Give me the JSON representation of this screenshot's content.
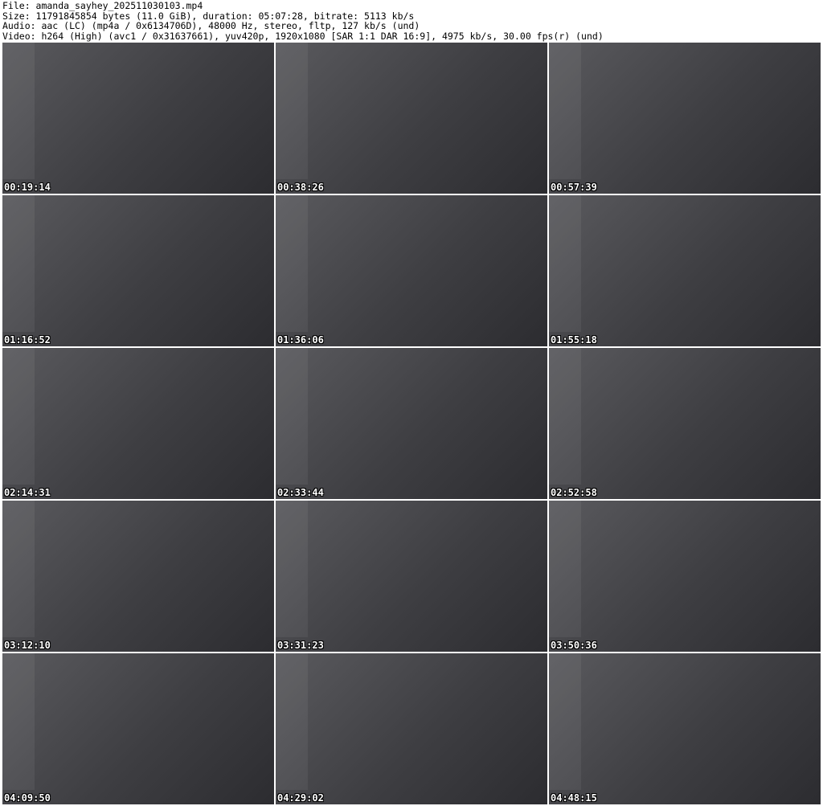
{
  "header": {
    "file": "File: amanda_sayhey_202511030103.mp4",
    "size": "Size: 11791845854 bytes (11.0 GiB), duration: 05:07:28, bitrate: 5113 kb/s",
    "audio": "Audio: aac (LC) (mp4a / 0x6134706D), 48000 Hz, stereo, fltp, 127 kb/s (und)",
    "video": "Video: h264 (High) (avc1 / 0x31637661), yuv420p, 1920x1080 [SAR 1:1 DAR 16:9], 4975 kb/s, 30.00 fps(r) (und)"
  },
  "thumbnails": [
    {
      "timestamp": "00:19:14"
    },
    {
      "timestamp": "00:38:26"
    },
    {
      "timestamp": "00:57:39"
    },
    {
      "timestamp": "01:16:52"
    },
    {
      "timestamp": "01:36:06"
    },
    {
      "timestamp": "01:55:18"
    },
    {
      "timestamp": "02:14:31"
    },
    {
      "timestamp": "02:33:44"
    },
    {
      "timestamp": "02:52:58"
    },
    {
      "timestamp": "03:12:10"
    },
    {
      "timestamp": "03:31:23"
    },
    {
      "timestamp": "03:50:36"
    },
    {
      "timestamp": "04:09:50"
    },
    {
      "timestamp": "04:29:02"
    },
    {
      "timestamp": "04:48:15"
    }
  ]
}
